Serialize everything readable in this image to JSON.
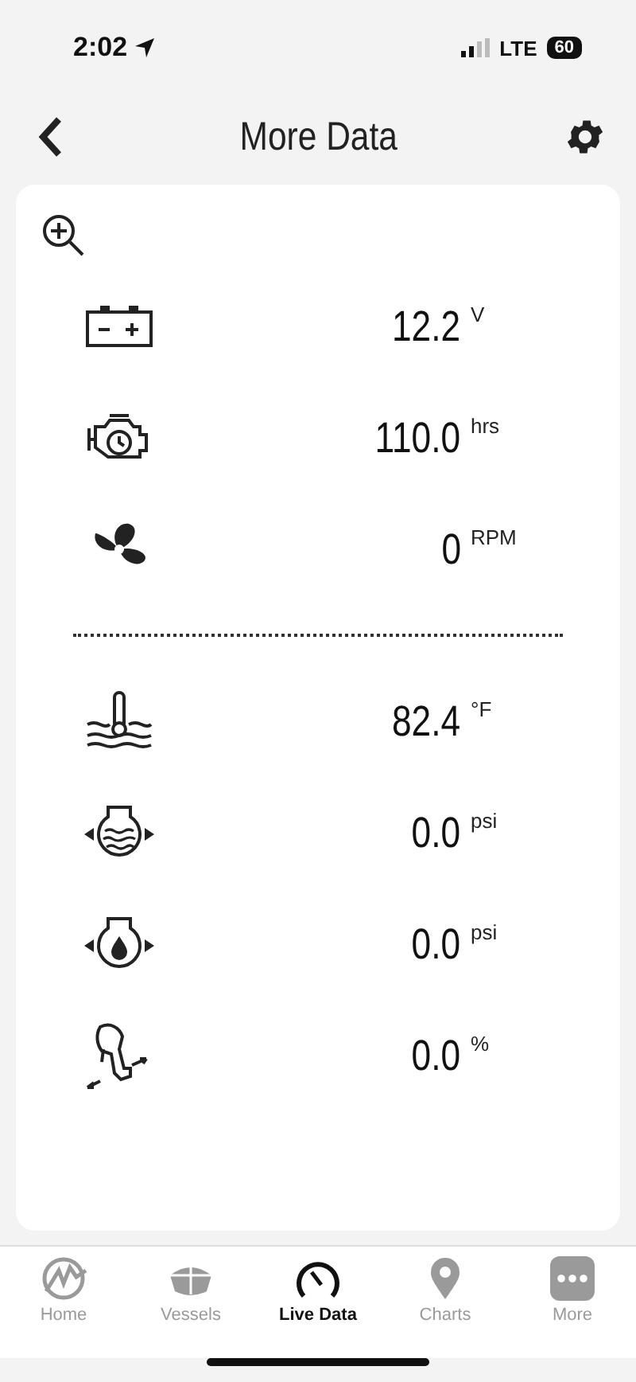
{
  "status_bar": {
    "time": "2:02",
    "network": "LTE",
    "battery": "60"
  },
  "header": {
    "title": "More Data"
  },
  "groups": [
    {
      "readings": [
        {
          "kind": "battery",
          "value": "12.2",
          "unit": "V"
        },
        {
          "kind": "engine-hours",
          "value": "110.0",
          "unit": "hrs"
        },
        {
          "kind": "propeller",
          "value": "0",
          "unit": "RPM"
        }
      ]
    },
    {
      "readings": [
        {
          "kind": "water-temp",
          "value": "82.4",
          "unit": "°F"
        },
        {
          "kind": "water-pressure",
          "value": "0.0",
          "unit": "psi"
        },
        {
          "kind": "oil-pressure",
          "value": "0.0",
          "unit": "psi"
        },
        {
          "kind": "trim",
          "value": "0.0",
          "unit": "%"
        }
      ]
    }
  ],
  "tabs": [
    {
      "kind": "home",
      "label": "Home",
      "selected": false
    },
    {
      "kind": "vessels",
      "label": "Vessels",
      "selected": false
    },
    {
      "kind": "live",
      "label": "Live Data",
      "selected": true
    },
    {
      "kind": "charts",
      "label": "Charts",
      "selected": false
    },
    {
      "kind": "more",
      "label": "More",
      "selected": false
    }
  ]
}
